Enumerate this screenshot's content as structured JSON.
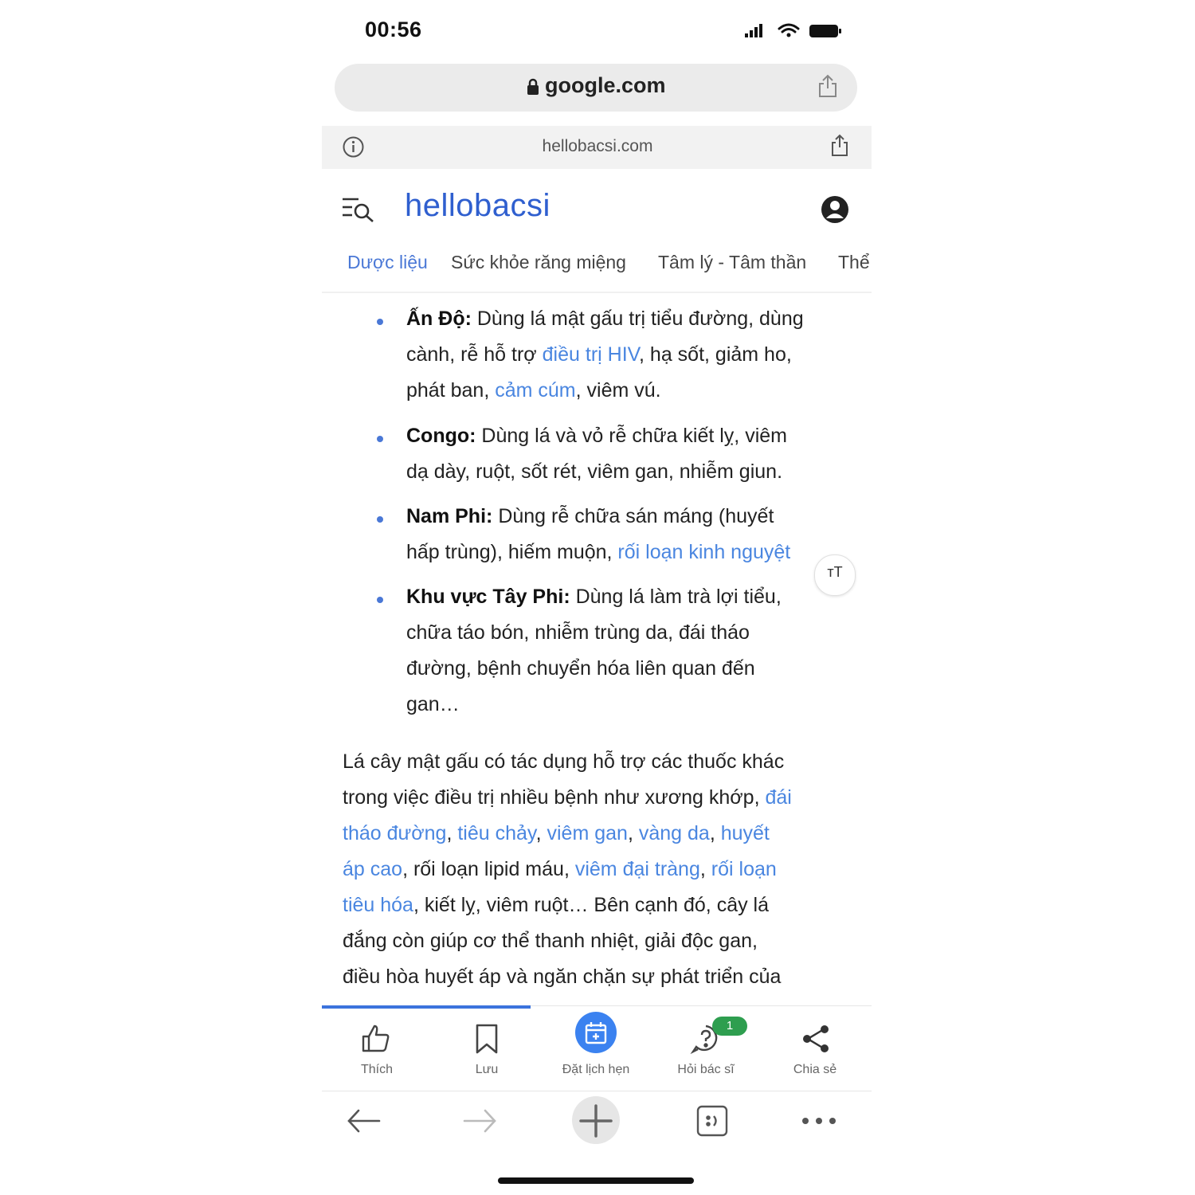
{
  "status_bar": {
    "time": "00:56"
  },
  "browser": {
    "url": "google.com",
    "amp_url": "hellobacsi.com"
  },
  "site": {
    "logo": "hellobacsi",
    "nav": [
      "Dược liệu",
      "Sức khỏe răng miệng",
      "Tâm lý - Tâm thần",
      "Thể"
    ]
  },
  "article": {
    "bullets": [
      {
        "label": "Ấn Độ:",
        "lines": [
          [
            {
              "t": "Dùng lá mật gấu trị tiểu đường, dùng"
            }
          ],
          [
            {
              "t": "cành, rễ hỗ trợ "
            },
            {
              "t": "điều trị HIV",
              "link": true
            },
            {
              "t": ", hạ sốt, giảm ho,"
            }
          ],
          [
            {
              "t": "phát ban, "
            },
            {
              "t": "cảm cúm",
              "link": true
            },
            {
              "t": ", viêm vú."
            }
          ]
        ]
      },
      {
        "label": "Congo:",
        "lines": [
          [
            {
              "t": "Dùng lá và vỏ rễ chữa kiết lỵ, viêm"
            }
          ],
          [
            {
              "t": "dạ dày, ruột, sốt rét, viêm gan, nhiễm giun."
            }
          ]
        ]
      },
      {
        "label": "Nam Phi:",
        "lines": [
          [
            {
              "t": "Dùng rễ chữa sán máng (huyết"
            }
          ],
          [
            {
              "t": "hấp trùng), hiếm muộn, "
            },
            {
              "t": "rối loạn kinh nguyệt",
              "link": true
            }
          ]
        ]
      },
      {
        "label": "Khu vực Tây Phi:",
        "lines": [
          [
            {
              "t": "Dùng lá làm trà lợi tiểu,"
            }
          ],
          [
            {
              "t": "chữa táo bón, nhiễm trùng da, đái tháo"
            }
          ],
          [
            {
              "t": "đường, bệnh chuyển hóa liên quan đến"
            }
          ],
          [
            {
              "t": "gan…"
            }
          ]
        ]
      }
    ],
    "paragraph": [
      [
        {
          "t": "Lá cây mật gấu có tác dụng hỗ trợ các thuốc khác"
        }
      ],
      [
        {
          "t": "trong việc điều trị nhiều bệnh như xương khớp, "
        },
        {
          "t": "đái",
          "link": true
        }
      ],
      [
        {
          "t": "tháo đường",
          "link": true
        },
        {
          "t": ", "
        },
        {
          "t": "tiêu chảy",
          "link": true
        },
        {
          "t": ", "
        },
        {
          "t": "viêm gan",
          "link": true
        },
        {
          "t": ", "
        },
        {
          "t": "vàng da",
          "link": true
        },
        {
          "t": ", "
        },
        {
          "t": "huyết",
          "link": true
        }
      ],
      [
        {
          "t": "áp cao",
          "link": true
        },
        {
          "t": ", rối loạn lipid máu, "
        },
        {
          "t": "viêm đại tràng",
          "link": true
        },
        {
          "t": ", "
        },
        {
          "t": "rối loạn",
          "link": true
        }
      ],
      [
        {
          "t": "tiêu hóa",
          "link": true
        },
        {
          "t": ", kiết lỵ, viêm ruột… Bên cạnh đó, cây lá"
        }
      ],
      [
        {
          "t": "đắng còn giúp cơ thể thanh nhiệt, giải độc gan,"
        }
      ],
      [
        {
          "t": "điều hòa huyết áp và ngăn chặn sự phát triển của"
        }
      ]
    ]
  },
  "text_size_label": "тT",
  "action_bar": {
    "like": "Thích",
    "save": "Lưu",
    "book": "Đặt lịch hẹn",
    "ask": "Hỏi bác sĩ",
    "ask_badge": "1",
    "share": "Chia sẻ",
    "reading_progress": 0.38
  },
  "colors": {
    "link": "#4a86e0",
    "brand": "#2f5fcf",
    "accent": "#3b82f0",
    "badge": "#2e9e4f"
  }
}
